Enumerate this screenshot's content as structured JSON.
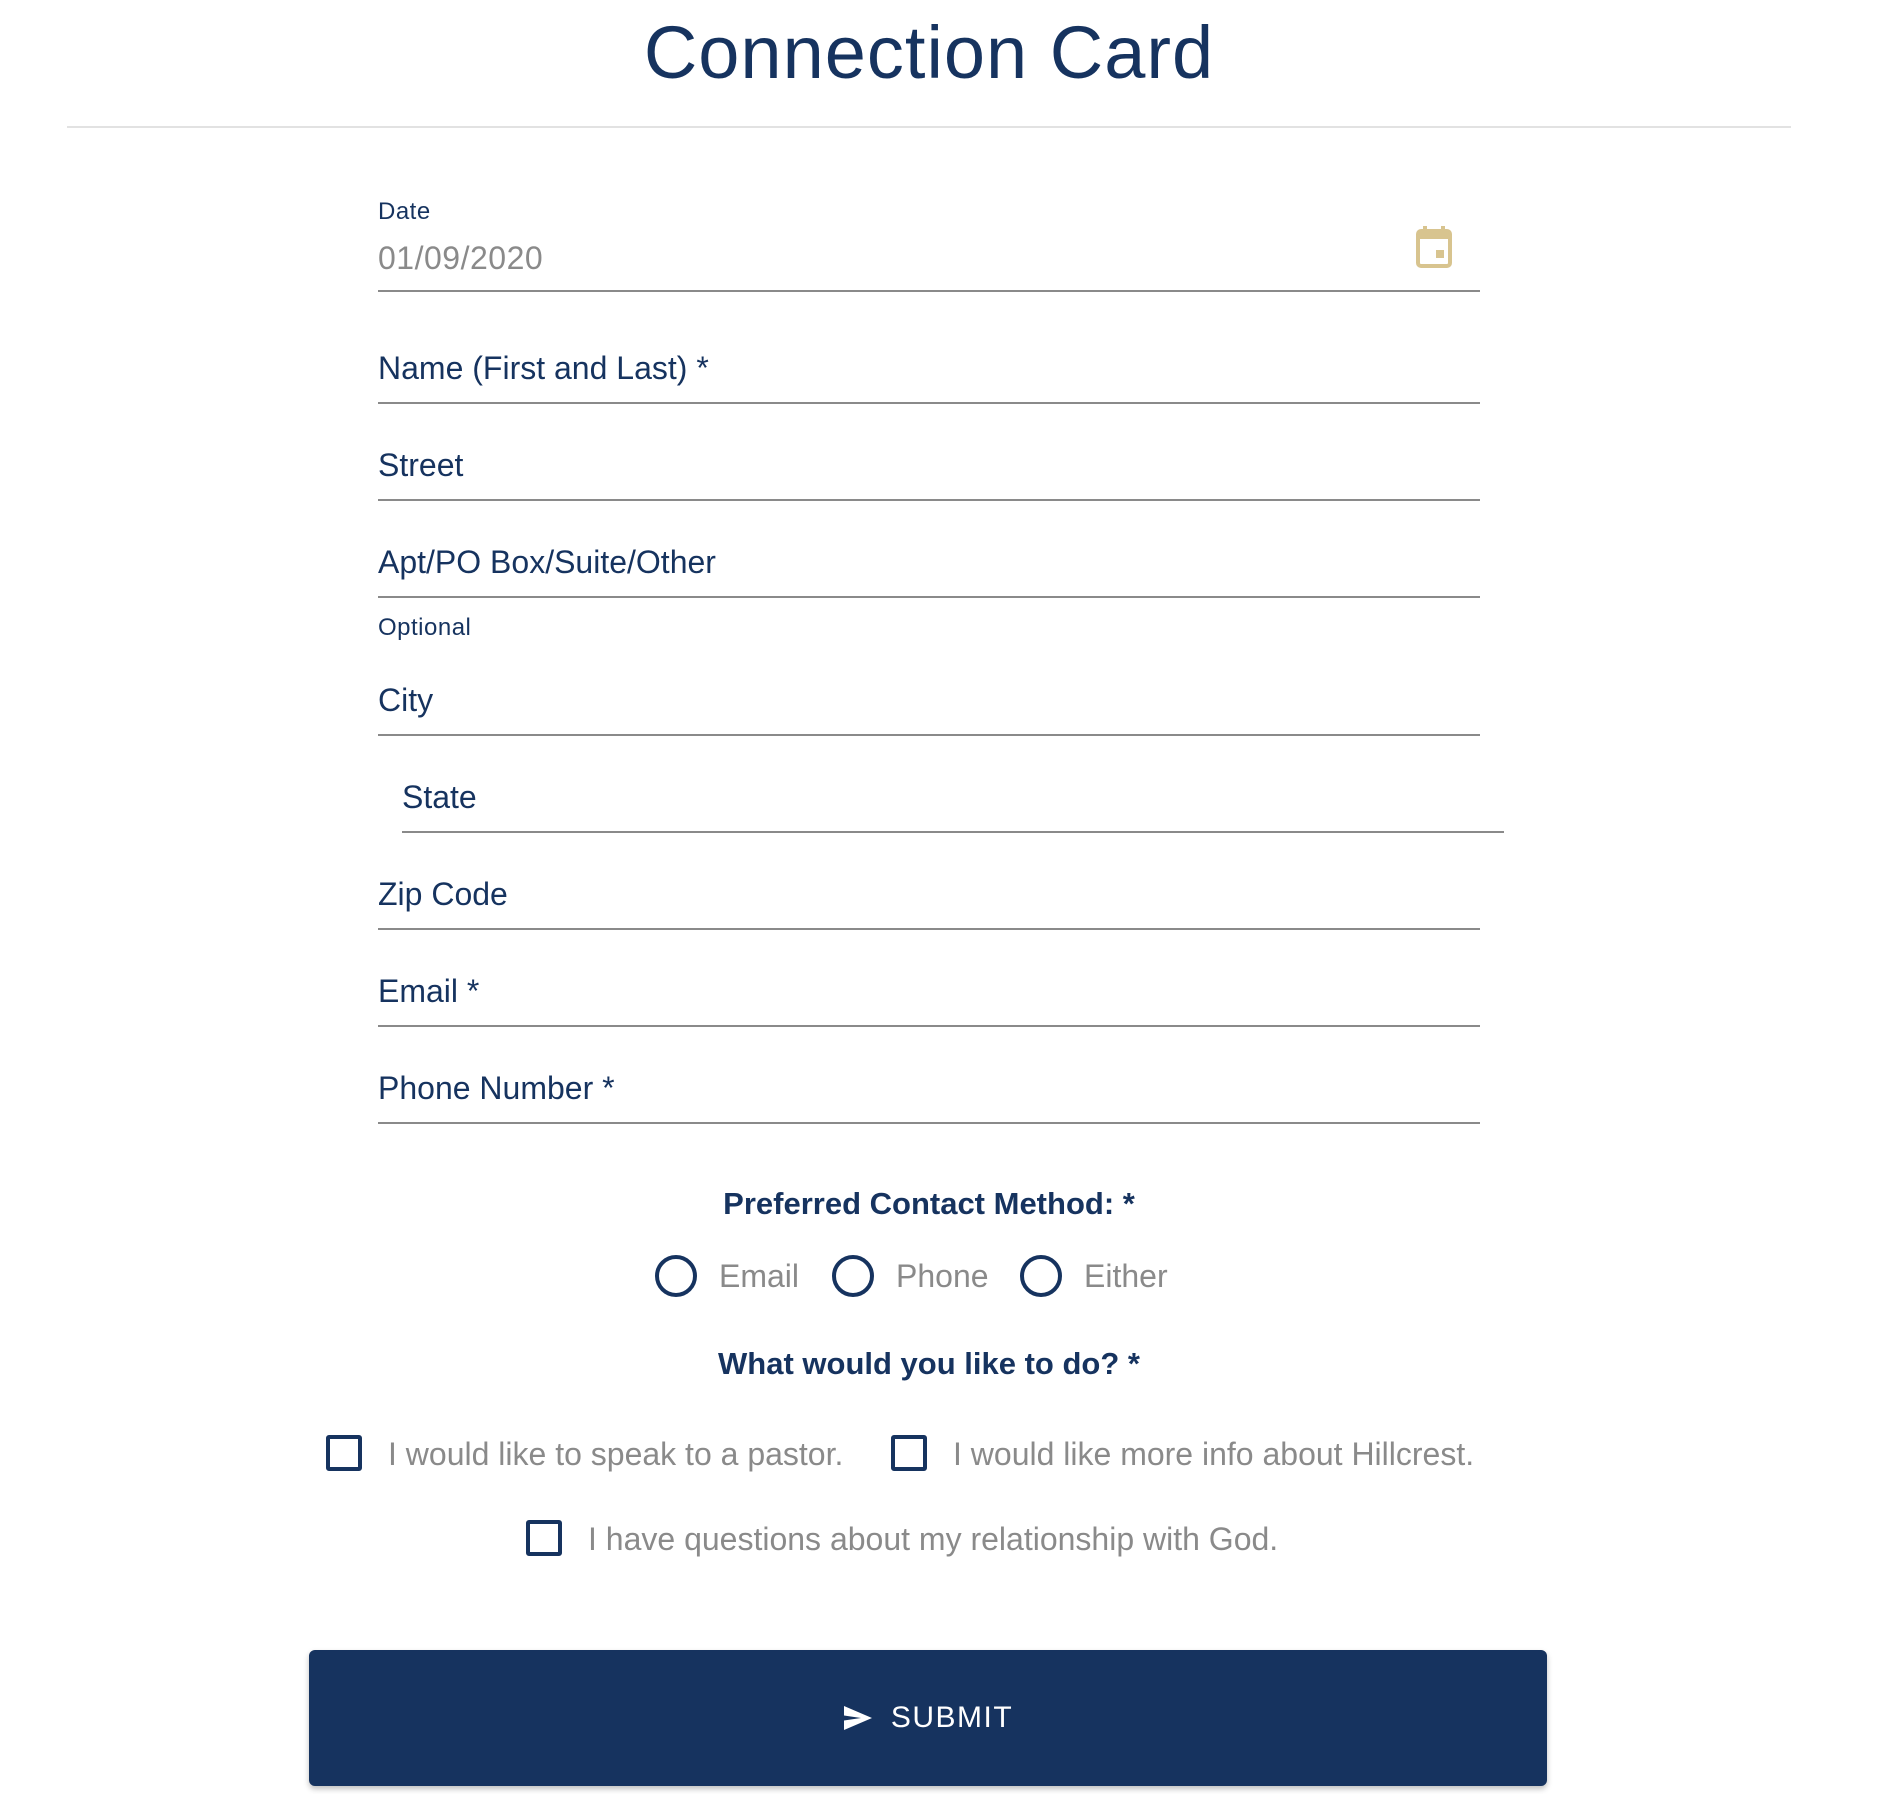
{
  "page": {
    "title": "Connection Card"
  },
  "fields": {
    "date": {
      "label": "Date",
      "value": "01/09/2020",
      "icon": "calendar-icon"
    },
    "name": {
      "label": "Name (First and Last) *"
    },
    "street": {
      "label": "Street"
    },
    "apt": {
      "label": "Apt/PO Box/Suite/Other",
      "hint": "Optional"
    },
    "city": {
      "label": "City"
    },
    "state": {
      "label": "State"
    },
    "zip": {
      "label": "Zip Code"
    },
    "email": {
      "label": "Email *"
    },
    "phone": {
      "label": "Phone Number *"
    }
  },
  "contact_method": {
    "heading": "Preferred Contact Method: *",
    "options": [
      "Email",
      "Phone",
      "Either"
    ]
  },
  "actions": {
    "heading": "What would you like to do? *",
    "options": [
      "I would like to speak to a pastor.",
      "I would like more info about Hillcrest.",
      "I have questions about my relationship with God."
    ]
  },
  "submit": {
    "label": "SUBMIT",
    "icon": "send-icon"
  },
  "colors": {
    "primary": "#16335f",
    "accent_icon": "#d8c48f",
    "muted_text": "#8a8a8a",
    "divider": "#e2e2e2"
  }
}
